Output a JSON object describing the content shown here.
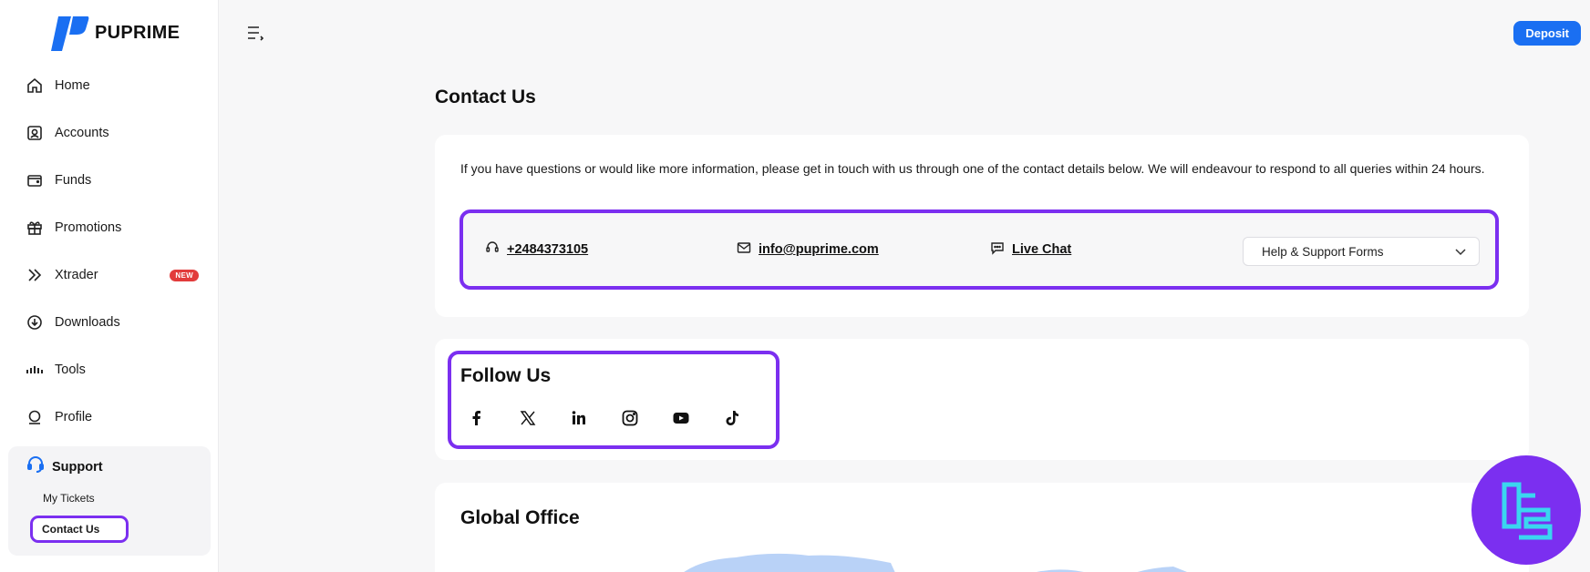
{
  "brand": {
    "name": "PUPRIME",
    "accent": "#7b2ff0",
    "primary_blue": "#1a6ff2"
  },
  "sidebar": {
    "items": [
      {
        "label": "Home",
        "icon": "home-icon"
      },
      {
        "label": "Accounts",
        "icon": "account-icon"
      },
      {
        "label": "Funds",
        "icon": "wallet-icon"
      },
      {
        "label": "Promotions",
        "icon": "gift-icon"
      },
      {
        "label": "Xtrader",
        "icon": "xtrader-icon",
        "badge": "NEW"
      },
      {
        "label": "Downloads",
        "icon": "download-icon"
      },
      {
        "label": "Tools",
        "icon": "tools-icon"
      },
      {
        "label": "Profile",
        "icon": "profile-icon"
      }
    ],
    "support": {
      "label": "Support",
      "icon": "headset-icon",
      "children": [
        {
          "label": "My Tickets"
        },
        {
          "label": "Contact Us",
          "selected": true
        }
      ]
    }
  },
  "header": {
    "deposit_label": "Deposit"
  },
  "main": {
    "title": "Contact Us",
    "intro": "If you have questions or would like more information, please get in touch with us through one of the contact details below. We will endeavour to respond to all queries within 24 hours.",
    "contacts": {
      "phone": "+2484373105",
      "email": "info@puprime.com",
      "chat": "Live Chat",
      "forms_select": "Help & Support Forms"
    },
    "follow": {
      "title": "Follow Us",
      "networks": [
        "facebook-icon",
        "x-twitter-icon",
        "linkedin-icon",
        "instagram-icon",
        "youtube-icon",
        "tiktok-icon"
      ]
    },
    "office": {
      "title": "Global Office"
    }
  }
}
